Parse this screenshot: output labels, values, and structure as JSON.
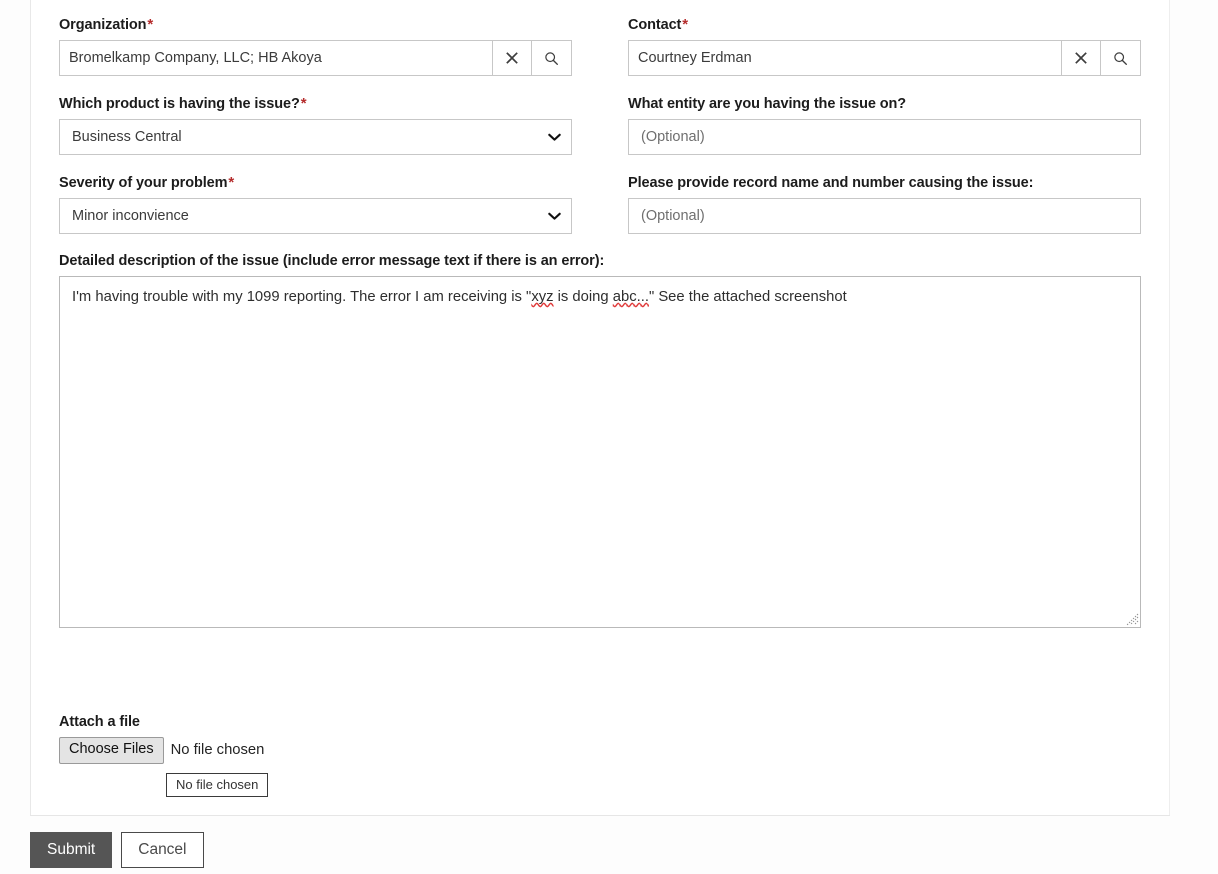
{
  "form": {
    "fields": {
      "organization": {
        "label": "Organization",
        "required_marker": "*",
        "value": "Bromelkamp Company, LLC; HB Akoya",
        "clear_icon": "close-x-icon",
        "search_icon": "magnifier-icon"
      },
      "contact": {
        "label": "Contact",
        "required_marker": "*",
        "value": "Courtney Erdman",
        "clear_icon": "close-x-icon",
        "search_icon": "magnifier-icon"
      },
      "product": {
        "label": "Which product is having the issue?",
        "required_marker": "*",
        "value": "Business Central",
        "options": [
          "Business Central"
        ]
      },
      "entity": {
        "label": "What entity are you having the issue on?",
        "required_marker": "",
        "value": "",
        "placeholder": "(Optional)"
      },
      "severity": {
        "label": "Severity of your problem",
        "required_marker": "*",
        "value": "Minor inconvience",
        "options": [
          "Minor inconvience"
        ]
      },
      "record": {
        "label": "Please provide record name and number causing the issue:",
        "required_marker": "",
        "value": "",
        "placeholder": "(Optional)"
      },
      "description": {
        "label": "Detailed description of the issue (include error message text if there is an error):",
        "required_marker": "",
        "text_part_1": "I'm having trouble with my 1099 reporting. The error I am receiving is \"",
        "misspelled_1": "xyz",
        "text_part_2": " is doing ",
        "misspelled_2": "abc...",
        "text_part_3": "\" See the attached screenshot"
      }
    },
    "attachment": {
      "label": "Attach a file",
      "choose_button": "Choose Files",
      "status": "No file chosen",
      "tooltip": "No file chosen"
    },
    "footer": {
      "submit_label": "Submit",
      "cancel_label": "Cancel"
    }
  },
  "colors": {
    "required_star": "#b52c2c",
    "submit_background": "#555555",
    "spellcheck_underline": "#e03b3b",
    "field_border": "#c7c7c7"
  }
}
